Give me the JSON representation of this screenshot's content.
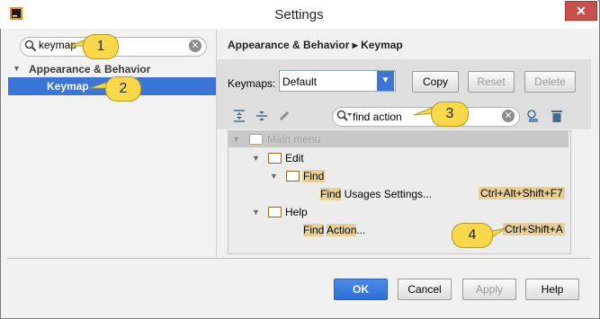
{
  "window": {
    "title": "Settings",
    "close_glyph": "✕"
  },
  "sidebar": {
    "search_value": "keymap",
    "clear_glyph": "✕",
    "tree": [
      {
        "label": "Appearance & Behavior",
        "expanded": true
      },
      {
        "label": "Keymap",
        "selected": true
      }
    ]
  },
  "main": {
    "breadcrumb": "Appearance & Behavior ▸ Keymap",
    "keymaps_label": "Keymaps:",
    "keymap_selected": "Default",
    "buttons": {
      "copy": "Copy",
      "reset": "Reset",
      "delete": "Delete"
    },
    "find_value": "find action",
    "tree": {
      "root": "Main menu",
      "edit": "Edit",
      "find": "Find",
      "find_usages_prefix": "Find",
      "find_usages_rest": " Usages Settings...",
      "find_usages_shortcut": "Ctrl+Alt+Shift+F7",
      "help": "Help",
      "find_action_a": "Find",
      "find_action_b": "Action",
      "find_action_rest": "...",
      "find_action_shortcut": "Ctrl+Shift+A"
    }
  },
  "footer": {
    "ok": "OK",
    "cancel": "Cancel",
    "apply": "Apply",
    "help": "Help"
  },
  "callouts": [
    "1",
    "2",
    "3",
    "4"
  ],
  "colors": {
    "selection": "#3b75d8",
    "highlight": "#e6d096",
    "callout": "#f9d94a",
    "close": "#c7504b"
  }
}
